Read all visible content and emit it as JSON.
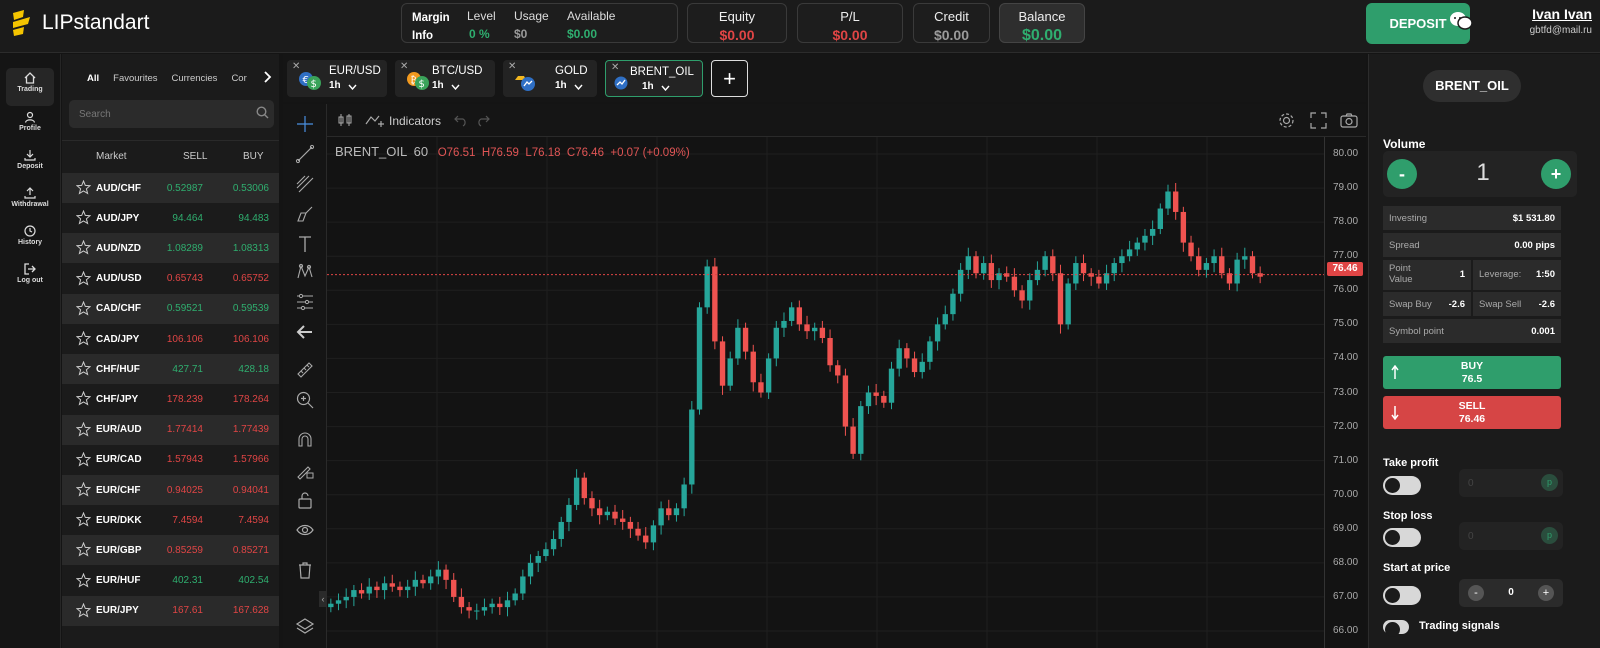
{
  "brand": {
    "name": "LIPstandart"
  },
  "metrics": {
    "margin_info": {
      "title_line1": "Margin",
      "title_line2": "Info",
      "level_label": "Level",
      "level_value": "0 %",
      "usage_label": "Usage",
      "usage_value": "$0",
      "available_label": "Available",
      "available_value": "$0.00"
    },
    "equity": {
      "label": "Equity",
      "value": "$0.00"
    },
    "pl": {
      "label": "P/L",
      "value": "$0.00"
    },
    "credit": {
      "label": "Credit",
      "value": "$0.00"
    },
    "balance": {
      "label": "Balance",
      "value": "$0.00"
    }
  },
  "header": {
    "deposit_label": "DEPOSIT",
    "user_name": "Ivan Ivan",
    "user_email": "gbtfd@mail.ru"
  },
  "nav": [
    {
      "label": "Trading"
    },
    {
      "label": "Profile"
    },
    {
      "label": "Deposit"
    },
    {
      "label": "Withdrawal"
    },
    {
      "label": "History"
    },
    {
      "label": "Log out"
    }
  ],
  "markets": {
    "tabs": [
      "All",
      "Favourites",
      "Currencies",
      "Cor"
    ],
    "search_placeholder": "Search",
    "columns": {
      "market": "Market",
      "sell": "SELL",
      "buy": "BUY"
    },
    "rows": [
      {
        "symbol": "AUD/CHF",
        "sell": "0.52987",
        "buy": "0.53006",
        "dir": "green"
      },
      {
        "symbol": "AUD/JPY",
        "sell": "94.464",
        "buy": "94.483",
        "dir": "green"
      },
      {
        "symbol": "AUD/NZD",
        "sell": "1.08289",
        "buy": "1.08313",
        "dir": "green"
      },
      {
        "symbol": "AUD/USD",
        "sell": "0.65743",
        "buy": "0.65752",
        "dir": "red"
      },
      {
        "symbol": "CAD/CHF",
        "sell": "0.59521",
        "buy": "0.59539",
        "dir": "green"
      },
      {
        "symbol": "CAD/JPY",
        "sell": "106.106",
        "buy": "106.106",
        "dir": "red"
      },
      {
        "symbol": "CHF/HUF",
        "sell": "427.71",
        "buy": "428.18",
        "dir": "green"
      },
      {
        "symbol": "CHF/JPY",
        "sell": "178.239",
        "buy": "178.264",
        "dir": "red"
      },
      {
        "symbol": "EUR/AUD",
        "sell": "1.77414",
        "buy": "1.77439",
        "dir": "red"
      },
      {
        "symbol": "EUR/CAD",
        "sell": "1.57943",
        "buy": "1.57966",
        "dir": "red"
      },
      {
        "symbol": "EUR/CHF",
        "sell": "0.94025",
        "buy": "0.94041",
        "dir": "red"
      },
      {
        "symbol": "EUR/DKK",
        "sell": "7.4594",
        "buy": "7.4594",
        "dir": "red"
      },
      {
        "symbol": "EUR/GBP",
        "sell": "0.85259",
        "buy": "0.85271",
        "dir": "red"
      },
      {
        "symbol": "EUR/HUF",
        "sell": "402.31",
        "buy": "402.54",
        "dir": "green"
      },
      {
        "symbol": "EUR/JPY",
        "sell": "167.61",
        "buy": "167.628",
        "dir": "red"
      }
    ]
  },
  "instrument_tabs": [
    {
      "name": "EUR/USD",
      "tf": "1h"
    },
    {
      "name": "BTC/USD",
      "tf": "1h"
    },
    {
      "name": "GOLD",
      "tf": "1h"
    },
    {
      "name": "BRENT_OIL",
      "tf": "1h"
    }
  ],
  "chart_toolbar": {
    "indicators_label": "Indicators"
  },
  "chart_data": {
    "type": "candlestick",
    "symbol": "BRENT_OIL",
    "interval": "60",
    "ohlc": {
      "open": "O76.51",
      "high": "H76.59",
      "low": "L76.18",
      "close": "C76.46",
      "change": "+0.07 (+0.09%)"
    },
    "last_price": "76.46",
    "ylim": [
      65.5,
      80.5
    ],
    "y_ticks": [
      "80.00",
      "79.00",
      "78.00",
      "77.00",
      "76.00",
      "75.00",
      "74.00",
      "73.00",
      "72.00",
      "71.00",
      "70.00",
      "69.00",
      "68.00",
      "67.00",
      "66.00"
    ],
    "up_color": "#26a69a",
    "down_color": "#ef5350",
    "closes": [
      66.8,
      66.9,
      67.0,
      67.2,
      67.1,
      67.3,
      67.2,
      67.4,
      67.3,
      67.2,
      67.3,
      67.5,
      67.4,
      67.6,
      67.8,
      67.5,
      67.0,
      66.7,
      66.6,
      66.6,
      66.7,
      66.8,
      66.7,
      66.9,
      67.1,
      67.6,
      68.0,
      68.2,
      68.4,
      68.7,
      69.2,
      69.7,
      70.5,
      69.9,
      69.6,
      69.4,
      69.5,
      69.3,
      69.2,
      69.0,
      68.8,
      68.6,
      69.1,
      69.6,
      69.4,
      69.6,
      70.3,
      72.5,
      75.5,
      76.7,
      74.5,
      73.2,
      74.0,
      74.9,
      74.2,
      73.3,
      73.0,
      74.0,
      74.9,
      75.1,
      75.5,
      75.0,
      74.8,
      74.9,
      74.6,
      73.8,
      73.5,
      72.0,
      71.2,
      72.6,
      73.0,
      72.9,
      72.7,
      73.7,
      74.3,
      74.0,
      73.6,
      73.9,
      74.5,
      75.0,
      75.3,
      75.9,
      76.6,
      77.0,
      76.5,
      76.8,
      76.3,
      76.5,
      76.4,
      76.0,
      75.7,
      76.3,
      76.6,
      77.0,
      76.5,
      75.0,
      76.2,
      76.8,
      76.5,
      76.4,
      76.2,
      76.5,
      76.8,
      77.0,
      77.2,
      77.4,
      77.6,
      77.8,
      78.4,
      78.9,
      78.3,
      77.4,
      77.0,
      76.6,
      76.8,
      77.0,
      76.5,
      76.2,
      76.9,
      77.0,
      76.5,
      76.4
    ]
  },
  "order_panel": {
    "symbol": "BRENT_OIL",
    "volume_label": "Volume",
    "volume_value": "1",
    "investing": {
      "label": "Investing",
      "value": "$1 531.80"
    },
    "spread": {
      "label": "Spread",
      "value": "0.00 pips"
    },
    "point_value": {
      "label": "Point Value",
      "value": "1"
    },
    "leverage": {
      "label": "Leverage:",
      "value": "1:50"
    },
    "swap_buy": {
      "label": "Swap Buy",
      "value": "-2.6"
    },
    "swap_sell": {
      "label": "Swap Sell",
      "value": "-2.6"
    },
    "symbol_point": {
      "label": "Symbol point",
      "value": "0.001"
    },
    "buy": {
      "label": "BUY",
      "price": "76.5"
    },
    "sell": {
      "label": "SELL",
      "price": "76.46"
    },
    "take_profit": {
      "label": "Take profit",
      "placeholder": "0"
    },
    "stop_loss": {
      "label": "Stop loss",
      "placeholder": "0"
    },
    "start_at_price": {
      "label": "Start at price",
      "value": "0"
    },
    "trading_signals": {
      "label": "Trading signals"
    }
  }
}
